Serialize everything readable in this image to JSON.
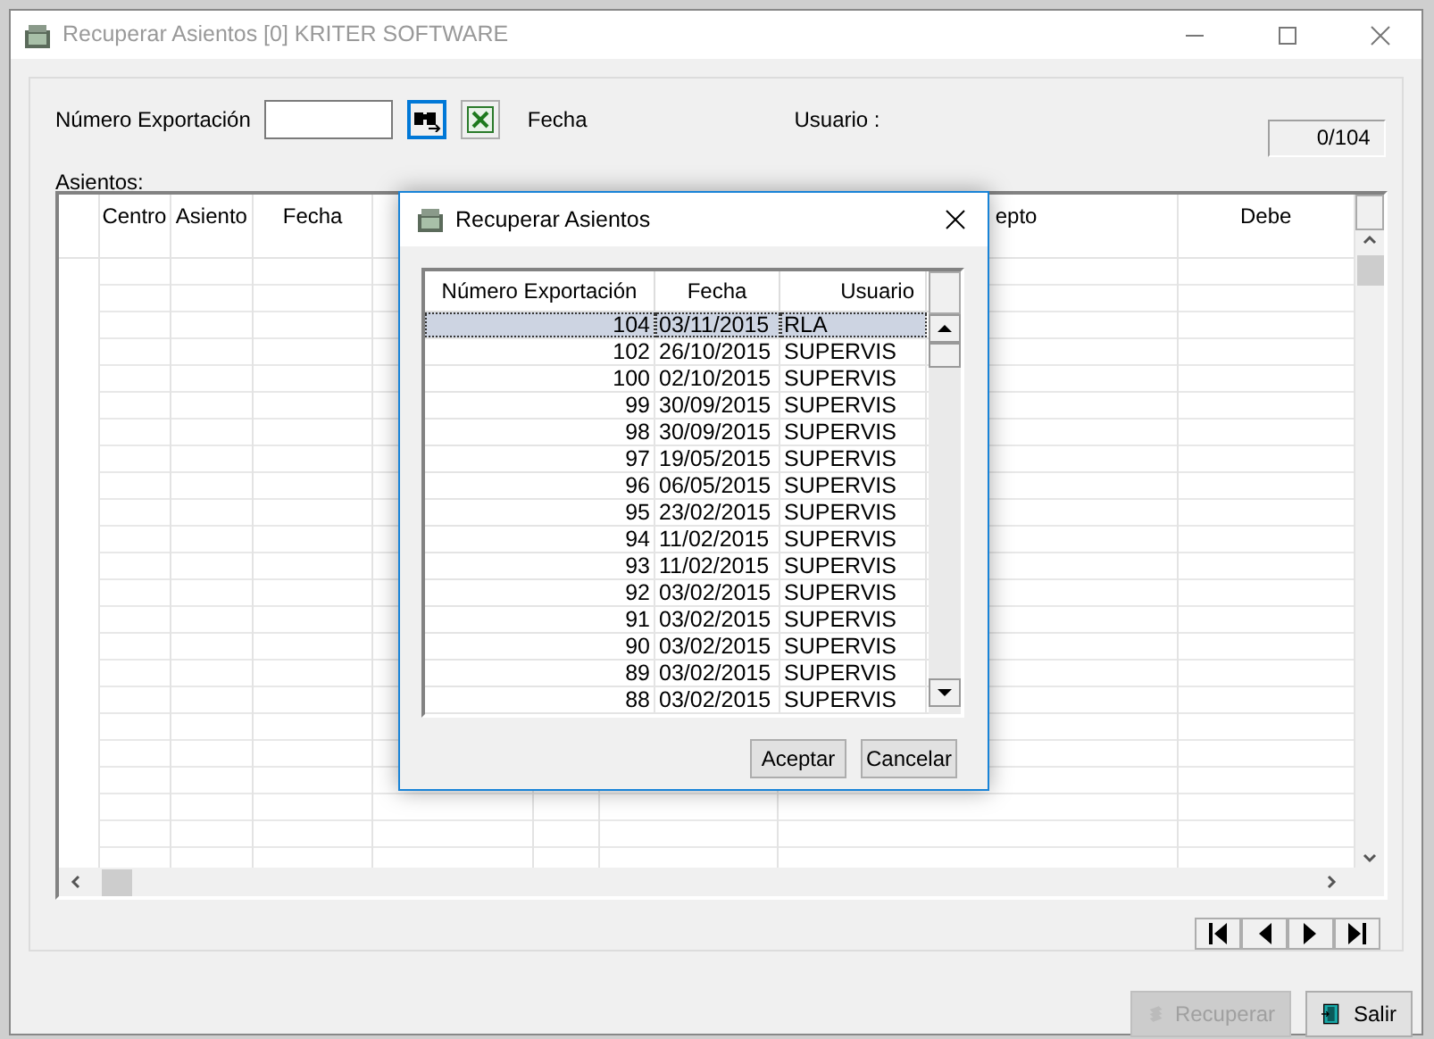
{
  "window": {
    "title": "Recuperar Asientos [0] KRITER SOFTWARE"
  },
  "filter": {
    "export_label": "Número Exportación",
    "fecha_label": "Fecha",
    "usuario_label": "Usuario :",
    "counter": "0/104"
  },
  "grid": {
    "label": "Asientos:",
    "columns": [
      {
        "label": "Centro"
      },
      {
        "label": "Asiento"
      },
      {
        "label": "Fecha"
      },
      {
        "label": "epto"
      },
      {
        "label": "Debe"
      }
    ]
  },
  "buttons": [
    {
      "label": "Recuperar",
      "disabled": true
    },
    {
      "label": "Salir",
      "disabled": false
    }
  ],
  "dialog": {
    "title": "Recuperar Asientos",
    "columns": [
      "Número Exportación",
      "Fecha",
      "Usuario"
    ],
    "rows": [
      {
        "numero": "104",
        "fecha": "03/11/2015",
        "usuario": "RLA",
        "selected": true
      },
      {
        "numero": "102",
        "fecha": "26/10/2015",
        "usuario": "SUPERVIS",
        "selected": false
      },
      {
        "numero": "100",
        "fecha": "02/10/2015",
        "usuario": "SUPERVIS",
        "selected": false
      },
      {
        "numero": "99",
        "fecha": "30/09/2015",
        "usuario": "SUPERVIS",
        "selected": false
      },
      {
        "numero": "98",
        "fecha": "30/09/2015",
        "usuario": "SUPERVIS",
        "selected": false
      },
      {
        "numero": "97",
        "fecha": "19/05/2015",
        "usuario": "SUPERVIS",
        "selected": false
      },
      {
        "numero": "96",
        "fecha": "06/05/2015",
        "usuario": "SUPERVIS",
        "selected": false
      },
      {
        "numero": "95",
        "fecha": "23/02/2015",
        "usuario": "SUPERVIS",
        "selected": false
      },
      {
        "numero": "94",
        "fecha": "11/02/2015",
        "usuario": "SUPERVIS",
        "selected": false
      },
      {
        "numero": "93",
        "fecha": "11/02/2015",
        "usuario": "SUPERVIS",
        "selected": false
      },
      {
        "numero": "92",
        "fecha": "03/02/2015",
        "usuario": "SUPERVIS",
        "selected": false
      },
      {
        "numero": "91",
        "fecha": "03/02/2015",
        "usuario": "SUPERVIS",
        "selected": false
      },
      {
        "numero": "90",
        "fecha": "03/02/2015",
        "usuario": "SUPERVIS",
        "selected": false
      },
      {
        "numero": "89",
        "fecha": "03/02/2015",
        "usuario": "SUPERVIS",
        "selected": false
      },
      {
        "numero": "88",
        "fecha": "03/02/2015",
        "usuario": "SUPERVIS",
        "selected": false
      }
    ],
    "buttons": [
      {
        "label": "Aceptar"
      },
      {
        "label": "Cancelar"
      }
    ]
  }
}
